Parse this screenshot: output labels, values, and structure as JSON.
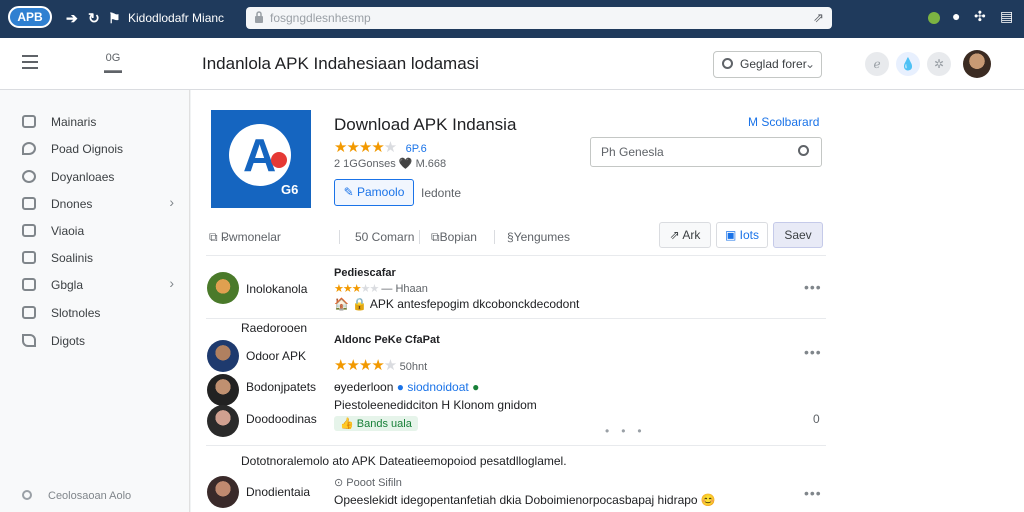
{
  "browser": {
    "logo": "APB",
    "title": "Kidodlodafr Mianc",
    "url": "fosgngdlesnhesmp",
    "colors": {
      "bar": "#1f3a5c",
      "accent": "#1a73e8"
    }
  },
  "header": {
    "mini_label": "0G",
    "title": "Indanlola APK Indahesiaan lodamasi",
    "search_label": "Geglad forer"
  },
  "sidebar": {
    "items": [
      {
        "label": "Mainaris",
        "icon": "list-icon"
      },
      {
        "label": "Poad Oignois",
        "icon": "pin-icon"
      },
      {
        "label": "Doyanloaes",
        "icon": "download-icon"
      },
      {
        "label": "Dnones",
        "icon": "folder-icon"
      },
      {
        "label": "Viaoia",
        "icon": "video-icon"
      },
      {
        "label": "Soalinis",
        "icon": "settings-icon"
      },
      {
        "label": "Gbgla",
        "icon": "grid-icon"
      },
      {
        "label": "Slotnoles",
        "icon": "storage-icon"
      },
      {
        "label": "Digots",
        "icon": "tag-icon"
      }
    ],
    "footer": "Ceolosaoan Aolo"
  },
  "app": {
    "icon_badge": "G6",
    "name": "Download APK Indansia",
    "rating_value": "6P.6",
    "rating_stars": 4,
    "downloads": "2 1GGonses 🖤 M.668",
    "install_label": "Pamoolo",
    "details_label": "Iedonte",
    "scroll_link": "M Scolbarard",
    "search_placeholder": "Ph Genesla"
  },
  "filters": {
    "sort": "Pwmonelar",
    "count": "50 Comarn",
    "category": "Bopian",
    "extra": "Yengumes"
  },
  "toolbar": {
    "ark": "Ark",
    "lots": "Iots",
    "save": "Saev"
  },
  "comments": {
    "c1": {
      "user": "Inolokanola",
      "heading": "Pediescafar",
      "meta": "— Hhaan",
      "text": "🏠 🔒 APK antesfepogim dkcobonckdecodont"
    },
    "section_label": "Raedorooen",
    "c2": {
      "user": "Odoor APK",
      "title": "Aldonc PeKe CfaPat",
      "rating_text": "50hnt",
      "rating_stars": 4
    },
    "c3": {
      "user": "Bodonjpatets",
      "line1": "ɵyederloon",
      "line1_link": "siodnoidoat",
      "line2": "Piestoleenedidciton H Klonom gnidom",
      "chip": "Bands uala"
    },
    "c4": {
      "user": "Doodoodinas",
      "count": "0"
    },
    "bottom_heading": "Dototnoralemolo ato APK Dateatieemopoiod pesatdlloglamel.",
    "c5": {
      "user": "Dnodientaia",
      "meta": "Pooot Sifiln",
      "text": "Opeeslekidt idegopentanfetiah dkia Doboimienorpocasbapaj hidrapo 😊"
    }
  }
}
